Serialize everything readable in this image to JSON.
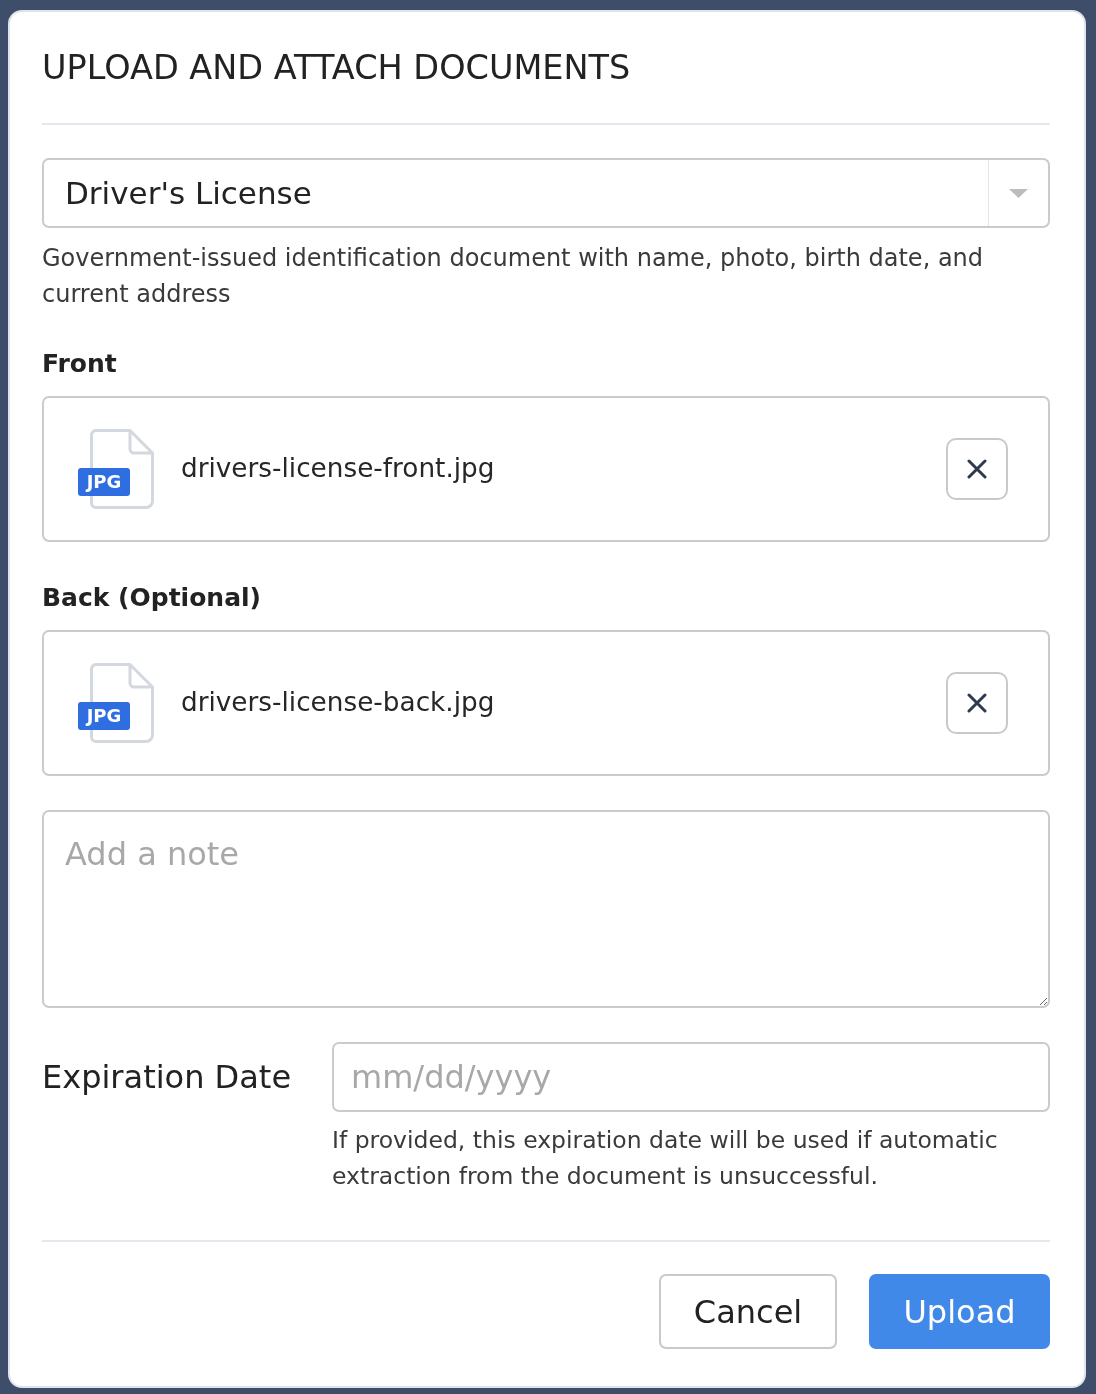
{
  "dialog": {
    "title": "UPLOAD AND ATTACH DOCUMENTS"
  },
  "document_type": {
    "value": "Driver's License",
    "description": "Government-issued identification document with name, photo, birth date, and current address"
  },
  "attachments": [
    {
      "label": "Front",
      "file_type": "JPG",
      "file_name": "drivers-license-front.jpg"
    },
    {
      "label": "Back (Optional)",
      "file_type": "JPG",
      "file_name": "drivers-license-back.jpg"
    }
  ],
  "note": {
    "placeholder": "Add a note"
  },
  "expiration_date": {
    "label": "Expiration Date",
    "placeholder": "mm/dd/yyyy",
    "help": "If provided, this expiration date will be used if automatic extraction from the document is unsuccessful."
  },
  "buttons": [
    {
      "label": "Cancel",
      "kind": "secondary"
    },
    {
      "label": "Upload",
      "kind": "primary"
    }
  ]
}
